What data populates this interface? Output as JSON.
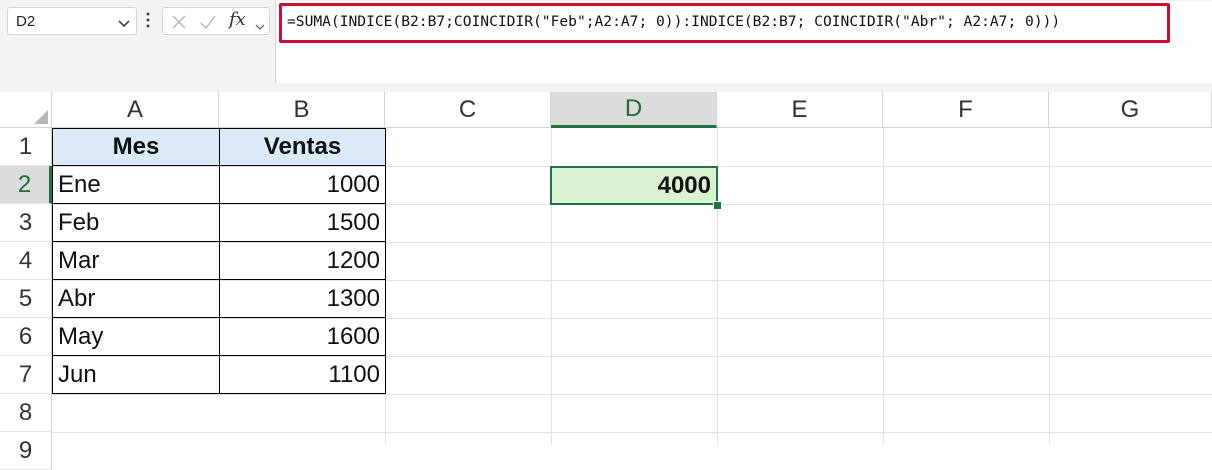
{
  "namebox": {
    "value": "D2"
  },
  "formula_bar": {
    "fx_label": "fx",
    "formula": "=SUMA(INDICE(B2:B7;COINCIDIR(\"Feb\";A2:A7; 0)):INDICE(B2:B7; COINCIDIR(\"Abr\"; A2:A7; 0)))"
  },
  "colors": {
    "accent": "#217346",
    "highlight_border": "#c8102e",
    "header_fill": "#dce9f7",
    "active_fill": "#d9f2d0"
  },
  "columns": [
    "A",
    "B",
    "C",
    "D",
    "E",
    "F",
    "G"
  ],
  "rows": [
    "1",
    "2",
    "3",
    "4",
    "5",
    "6",
    "7",
    "8",
    "9"
  ],
  "table": {
    "headers": {
      "mes": "Mes",
      "ventas": "Ventas"
    },
    "data": [
      {
        "mes": "Ene",
        "ventas": "1000"
      },
      {
        "mes": "Feb",
        "ventas": "1500"
      },
      {
        "mes": "Mar",
        "ventas": "1200"
      },
      {
        "mes": "Abr",
        "ventas": "1300"
      },
      {
        "mes": "May",
        "ventas": "1600"
      },
      {
        "mes": "Jun",
        "ventas": "1100"
      }
    ]
  },
  "active_cell": {
    "value": "4000"
  }
}
